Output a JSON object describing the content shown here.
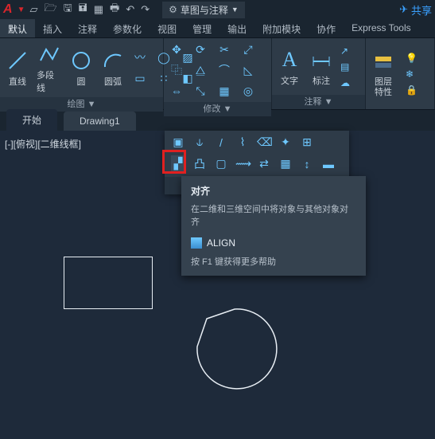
{
  "title_bar": {
    "workspace_label": "草图与注释",
    "share_label": "共享"
  },
  "ribbon_tabs": [
    "默认",
    "插入",
    "注释",
    "参数化",
    "视图",
    "管理",
    "输出",
    "附加模块",
    "协作",
    "Express Tools"
  ],
  "active_tab_index": 0,
  "draw_panel": {
    "title": "绘图 ▼",
    "btn_line": "直线",
    "btn_polyline": "多段线",
    "btn_circle": "圆",
    "btn_arc": "圆弧"
  },
  "modify_panel": {
    "title": "修改 ▼"
  },
  "annotation_panel": {
    "title": "注释 ▼",
    "btn_text": "文字",
    "btn_dim": "标注"
  },
  "layer_panel": {
    "btn_layerprops": "图层\n特性"
  },
  "doc_tabs": {
    "start": "开始",
    "drawing": "Drawing1"
  },
  "viewport_label": "[-][俯视][二维线框]",
  "modify_expanded": {
    "title": "修改"
  },
  "tooltip": {
    "title": "对齐",
    "desc": "在二维和三维空间中将对象与其他对象对齐",
    "command": "ALIGN",
    "help": "按 F1 键获得更多帮助"
  }
}
